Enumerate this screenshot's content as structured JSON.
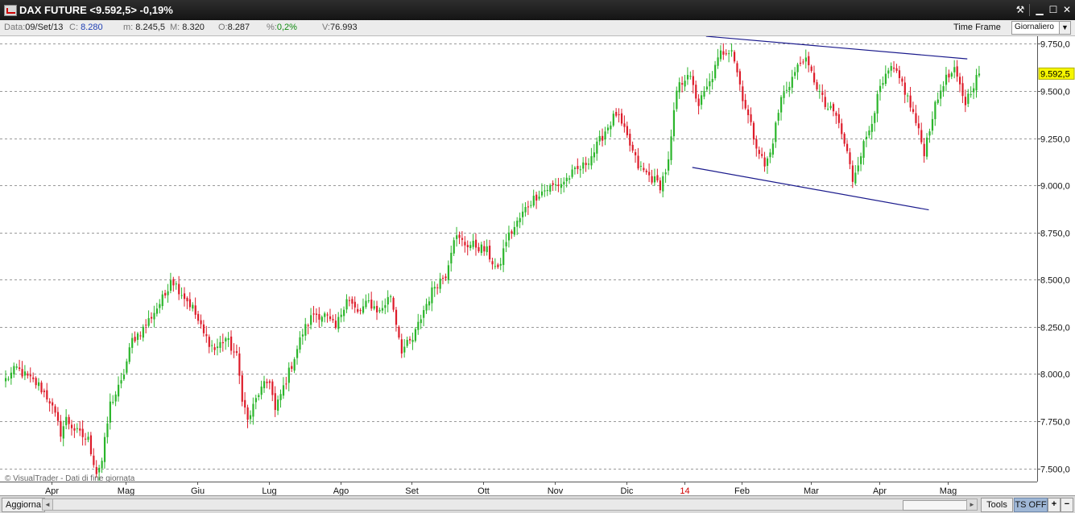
{
  "window": {
    "title": "DAX FUTURE <9.592,5> -0,19%",
    "controls": {
      "tool": "⚒",
      "minimize": "▁",
      "maximize": "☐",
      "close": "✕"
    }
  },
  "infobar": {
    "data_label": "Data:",
    "data_value": "09/Set/13",
    "c_label": "C:",
    "c_value": "8.280",
    "m_label": "m:",
    "m_value": "8.245,5",
    "M_label": "M:",
    "M_value": "8.320",
    "o_label": "O:",
    "o_value": "8.287",
    "pct_label": "%:",
    "pct_value": "0,2%",
    "v_label": "V:",
    "v_value": "76.993",
    "timeframe_label": "Time Frame",
    "timeframe_value": "Giornaliero",
    "timeframe_arrow": "▼"
  },
  "chart_data": {
    "type": "candlestick",
    "instrument": "DAX FUTURE",
    "last_price_label": "9.592,5",
    "watermark": "© VisualTrader - Dati di fine giornata",
    "ylim": [
      7430,
      9790
    ],
    "yticks": [
      7500,
      7750,
      8000,
      8250,
      8500,
      8750,
      9000,
      9250,
      9500,
      9750
    ],
    "ytick_labels": [
      "7.500,0",
      "7.750,0",
      "8.000,0",
      "8.250,0",
      "8.500,0",
      "8.750,0",
      "9.000,0",
      "9.250,0",
      "9.500,0",
      "9.750,0"
    ],
    "grid": "horizontal dashed",
    "x_labels": [
      "Apr",
      "Mag",
      "Giu",
      "Lug",
      "Ago",
      "Set",
      "Ott",
      "Nov",
      "Dic",
      "14",
      "Feb",
      "Mar",
      "Apr",
      "Mag"
    ],
    "x_label_bar_index": [
      17,
      44,
      70,
      96,
      122,
      148,
      174,
      200,
      226,
      247,
      268,
      293,
      318,
      343
    ],
    "highlight_labels": [
      "14"
    ],
    "bars_count": 355,
    "close_anchors": [
      [
        0,
        7970
      ],
      [
        4,
        8030
      ],
      [
        8,
        7980
      ],
      [
        12,
        7940
      ],
      [
        16,
        7860
      ],
      [
        20,
        7690
      ],
      [
        22,
        7760
      ],
      [
        26,
        7690
      ],
      [
        30,
        7650
      ],
      [
        33,
        7480
      ],
      [
        35,
        7540
      ],
      [
        38,
        7840
      ],
      [
        42,
        7950
      ],
      [
        46,
        8180
      ],
      [
        50,
        8240
      ],
      [
        54,
        8330
      ],
      [
        58,
        8420
      ],
      [
        60,
        8510
      ],
      [
        64,
        8430
      ],
      [
        68,
        8350
      ],
      [
        72,
        8210
      ],
      [
        76,
        8130
      ],
      [
        80,
        8190
      ],
      [
        84,
        8090
      ],
      [
        86,
        7880
      ],
      [
        88,
        7750
      ],
      [
        92,
        7900
      ],
      [
        96,
        7970
      ],
      [
        98,
        7800
      ],
      [
        100,
        7890
      ],
      [
        104,
        8050
      ],
      [
        108,
        8220
      ],
      [
        112,
        8320
      ],
      [
        116,
        8310
      ],
      [
        120,
        8240
      ],
      [
        124,
        8410
      ],
      [
        128,
        8320
      ],
      [
        132,
        8380
      ],
      [
        136,
        8330
      ],
      [
        140,
        8420
      ],
      [
        144,
        8130
      ],
      [
        148,
        8180
      ],
      [
        152,
        8340
      ],
      [
        156,
        8470
      ],
      [
        160,
        8530
      ],
      [
        163,
        8730
      ],
      [
        167,
        8690
      ],
      [
        171,
        8680
      ],
      [
        175,
        8650
      ],
      [
        179,
        8540
      ],
      [
        182,
        8710
      ],
      [
        186,
        8800
      ],
      [
        190,
        8900
      ],
      [
        194,
        8960
      ],
      [
        198,
        8990
      ],
      [
        202,
        9010
      ],
      [
        206,
        9060
      ],
      [
        210,
        9100
      ],
      [
        214,
        9180
      ],
      [
        218,
        9290
      ],
      [
        222,
        9380
      ],
      [
        226,
        9250
      ],
      [
        230,
        9100
      ],
      [
        234,
        9050
      ],
      [
        238,
        9000
      ],
      [
        241,
        9120
      ],
      [
        244,
        9500
      ],
      [
        248,
        9600
      ],
      [
        252,
        9430
      ],
      [
        256,
        9540
      ],
      [
        260,
        9700
      ],
      [
        264,
        9730
      ],
      [
        268,
        9470
      ],
      [
        272,
        9260
      ],
      [
        276,
        9100
      ],
      [
        278,
        9170
      ],
      [
        282,
        9460
      ],
      [
        286,
        9570
      ],
      [
        290,
        9680
      ],
      [
        294,
        9560
      ],
      [
        298,
        9420
      ],
      [
        302,
        9370
      ],
      [
        306,
        9170
      ],
      [
        308,
        9030
      ],
      [
        310,
        9130
      ],
      [
        314,
        9300
      ],
      [
        318,
        9510
      ],
      [
        322,
        9620
      ],
      [
        326,
        9540
      ],
      [
        330,
        9380
      ],
      [
        334,
        9180
      ],
      [
        337,
        9370
      ],
      [
        341,
        9550
      ],
      [
        345,
        9600
      ],
      [
        349,
        9440
      ],
      [
        352,
        9540
      ],
      [
        354,
        9592
      ]
    ],
    "ohlc_last": {
      "open": 8287,
      "high": 8320,
      "low": 8245.5,
      "close": 8280,
      "volume": 76993,
      "change_pct": 0.2
    },
    "trendlines": [
      {
        "color": "#1a1a8c",
        "from": [
          255,
          9790
        ],
        "to": [
          350,
          9670
        ]
      },
      {
        "color": "#1a1a8c",
        "from": [
          250,
          9095
        ],
        "to": [
          336,
          8870
        ]
      }
    ],
    "colors": {
      "up": "#2bb52b",
      "down": "#dd1c2a",
      "price_tag": "#f6f600",
      "grid": "#9a9a9a"
    }
  },
  "bottombar": {
    "refresh_label": "Aggiorna",
    "scroll_left": "◄",
    "scroll_right": "►",
    "tools_label": "Tools",
    "ts_label": "TS OFF",
    "zoom_in": "+",
    "zoom_out": "−"
  }
}
